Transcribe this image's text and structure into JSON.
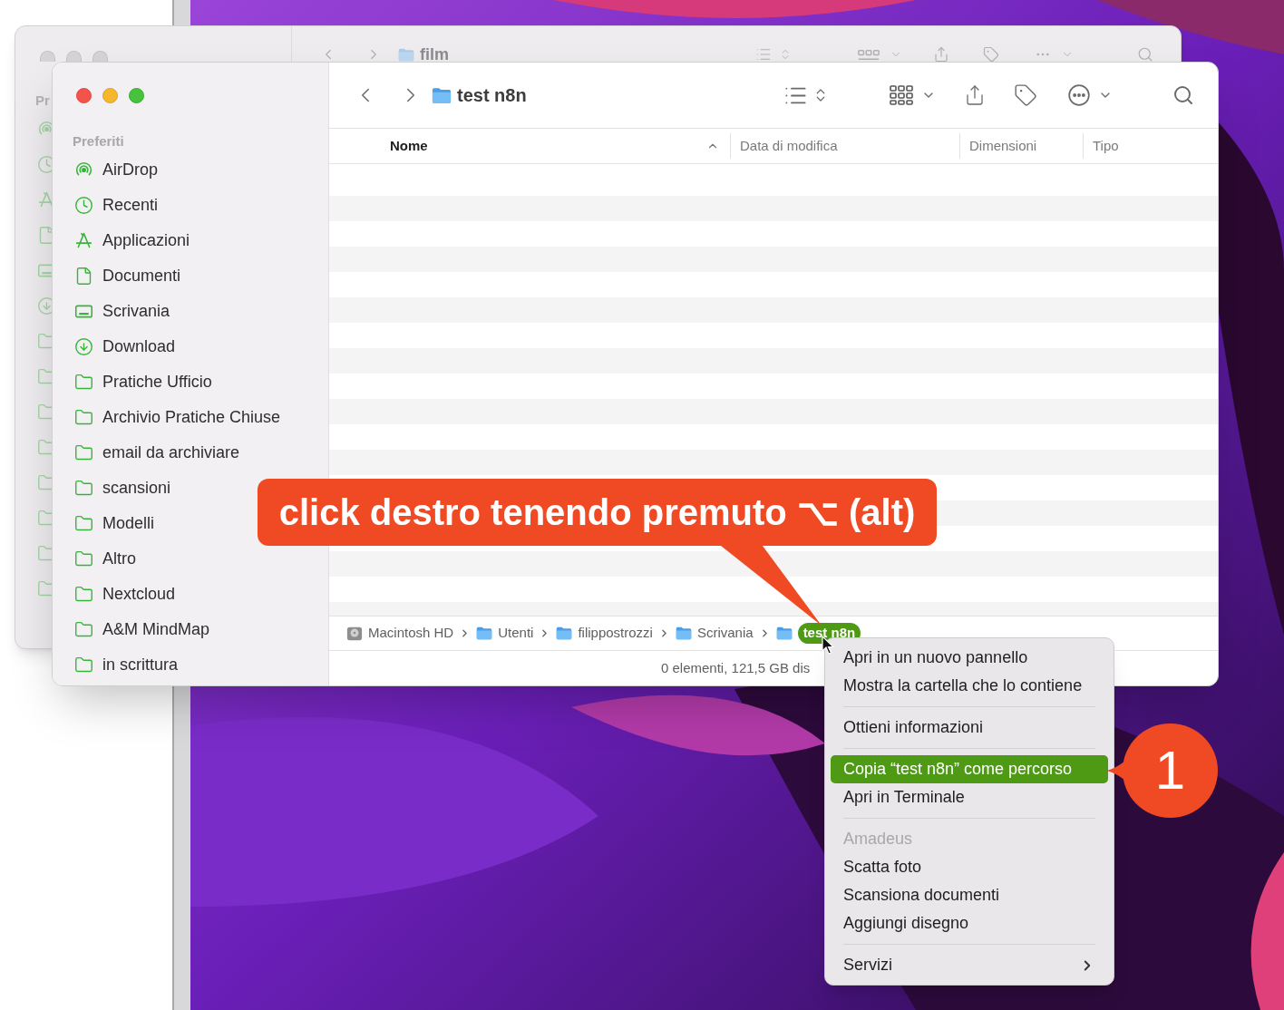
{
  "background_window": {
    "title": "film",
    "sidebar_heading": "Pr"
  },
  "window": {
    "title": "test n8n",
    "sidebar": {
      "heading": "Preferiti",
      "items": [
        {
          "label": "AirDrop",
          "kind": "airdrop",
          "selected": false
        },
        {
          "label": "Recenti",
          "kind": "clock",
          "selected": false
        },
        {
          "label": "Applicazioni",
          "kind": "apps",
          "selected": false
        },
        {
          "label": "Documenti",
          "kind": "document",
          "selected": false
        },
        {
          "label": "Scrivania",
          "kind": "desktop",
          "selected": false
        },
        {
          "label": "Download",
          "kind": "download",
          "selected": false
        },
        {
          "label": "Pratiche Ufficio",
          "kind": "folder",
          "selected": false
        },
        {
          "label": "Archivio Pratiche Chiuse",
          "kind": "folder",
          "selected": false
        },
        {
          "label": "email da archiviare",
          "kind": "folder",
          "selected": false
        },
        {
          "label": "scansioni",
          "kind": "folder",
          "selected": false
        },
        {
          "label": "Modelli",
          "kind": "folder",
          "selected": false
        },
        {
          "label": "Altro",
          "kind": "folder",
          "selected": false
        },
        {
          "label": "Nextcloud",
          "kind": "folder",
          "selected": false
        },
        {
          "label": "A&M MindMap",
          "kind": "folder",
          "selected": false
        },
        {
          "label": "in scrittura",
          "kind": "folder",
          "selected": false
        }
      ]
    },
    "columns": [
      {
        "label": "Nome",
        "sorted": true
      },
      {
        "label": "Data di modifica",
        "sorted": false
      },
      {
        "label": "Dimensioni",
        "sorted": false
      },
      {
        "label": "Tipo",
        "sorted": false
      }
    ],
    "path_bar": [
      {
        "label": "Macintosh HD",
        "kind": "disk",
        "selected": false
      },
      {
        "label": "Utenti",
        "kind": "folder",
        "selected": false
      },
      {
        "label": "filippostrozzi",
        "kind": "folder",
        "selected": false
      },
      {
        "label": "Scrivania",
        "kind": "folder",
        "selected": false
      },
      {
        "label": "test n8n",
        "kind": "folder",
        "selected": true
      }
    ],
    "status": "0 elementi, 121,5 GB dis"
  },
  "context_menu": {
    "sections": [
      {
        "items": [
          {
            "label": "Apri in un nuovo pannello",
            "selected": false,
            "disabled": false,
            "submenu": false
          },
          {
            "label": "Mostra la cartella che lo contiene",
            "selected": false,
            "disabled": false,
            "submenu": false
          }
        ]
      },
      {
        "items": [
          {
            "label": "Ottieni informazioni",
            "selected": false,
            "disabled": false,
            "submenu": false
          }
        ]
      },
      {
        "items": [
          {
            "label": "Copia “test n8n” come percorso",
            "selected": true,
            "disabled": false,
            "submenu": false
          },
          {
            "label": "Apri in Terminale",
            "selected": false,
            "disabled": false,
            "submenu": false
          }
        ]
      },
      {
        "items": [
          {
            "label": "Amadeus",
            "selected": false,
            "disabled": true,
            "submenu": false
          },
          {
            "label": "Scatta foto",
            "selected": false,
            "disabled": false,
            "submenu": false
          },
          {
            "label": "Scansiona documenti",
            "selected": false,
            "disabled": false,
            "submenu": false
          },
          {
            "label": "Aggiungi disegno",
            "selected": false,
            "disabled": false,
            "submenu": false
          }
        ]
      },
      {
        "items": [
          {
            "label": "Servizi",
            "selected": false,
            "disabled": false,
            "submenu": true
          }
        ]
      }
    ]
  },
  "annotation": {
    "text": "click destro tenendo premuto ⌥ (alt)",
    "step": "1"
  }
}
